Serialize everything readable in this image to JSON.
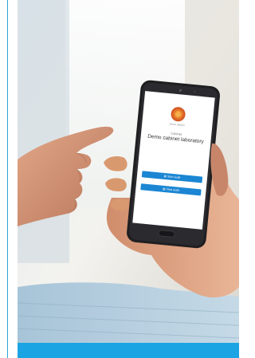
{
  "photo": {
    "alt_subject": "hand-holding-phone",
    "colors": {
      "accent": "#1aa4e4",
      "button": "#1b86d3",
      "logo": "#e8762a"
    }
  },
  "phone_screen": {
    "logo_caption": "Demo cabinet",
    "kicker": "Cabinet",
    "title": "Demo cabinet laboratory",
    "buttons": [
      {
        "label": "Start audit",
        "icon": "document-icon"
      },
      {
        "label": "Start audit",
        "icon": "document-icon"
      }
    ]
  }
}
